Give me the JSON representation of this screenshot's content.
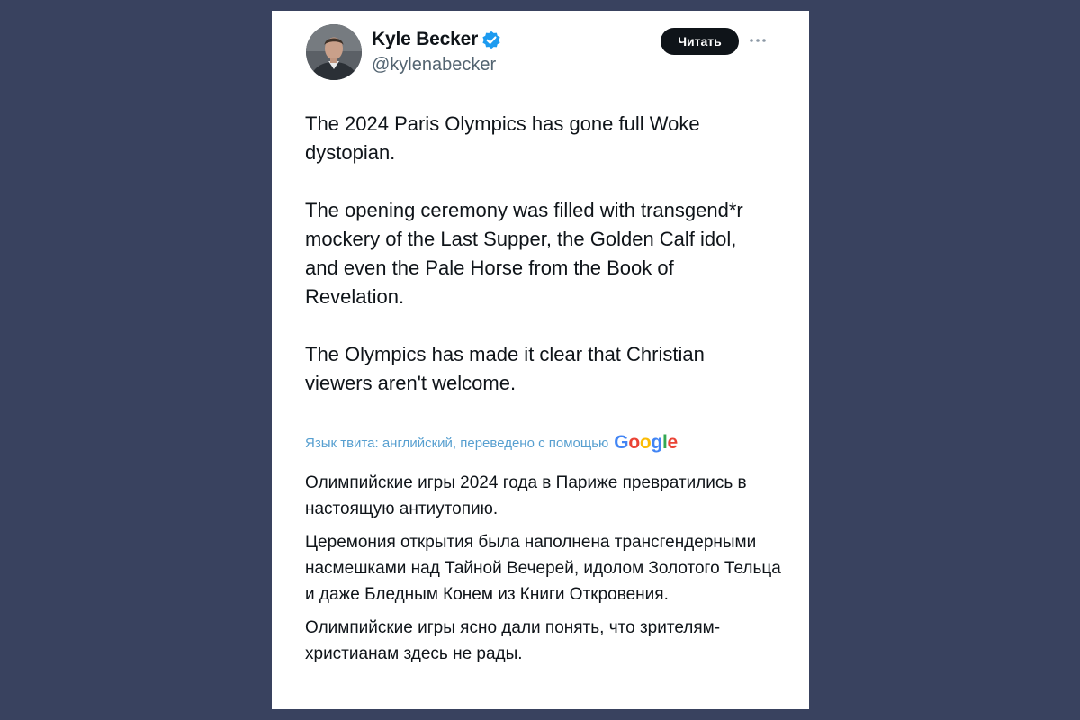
{
  "tweet": {
    "author": {
      "name": "Kyle Becker",
      "handle": "@kylenabecker",
      "verified": true,
      "avatar": "profile-photo"
    },
    "follow_label": "Читать",
    "more_icon": "ellipsis-icon",
    "paragraphs": [
      "The 2024 Paris Olympics has gone full Woke dystopian.",
      "The opening ceremony was filled with transgend*r mockery of the Last Supper, the Golden Calf idol, and even the Pale Horse from the Book of Revelation.",
      "The Olympics has made it clear that Christian viewers aren't welcome."
    ],
    "translation": {
      "label": "Язык твита: английский, переведено с помощью",
      "provider": "Google",
      "provider_colors": [
        "#4285F4",
        "#EA4335",
        "#FBBC05",
        "#4285F4",
        "#34A853",
        "#EA4335"
      ],
      "paragraphs": [
        "Олимпийские игры 2024 года в Париже превратились в настоящую антиутопию.",
        "Церемония открытия была наполнена трансгендерными насмешками над Тайной Вечерей, идолом Золотого Тельца и даже Бледным Конем из Книги Откровения.",
        "Олимпийские игры ясно дали понять, что зрителям-христианам здесь не рады."
      ]
    }
  },
  "colors": {
    "page_background": "#39425f",
    "card_background": "#ffffff",
    "text_primary": "#0f1419",
    "text_secondary": "#536471",
    "verified_blue": "#1d9bf0",
    "follow_button_bg": "#0f1419"
  }
}
